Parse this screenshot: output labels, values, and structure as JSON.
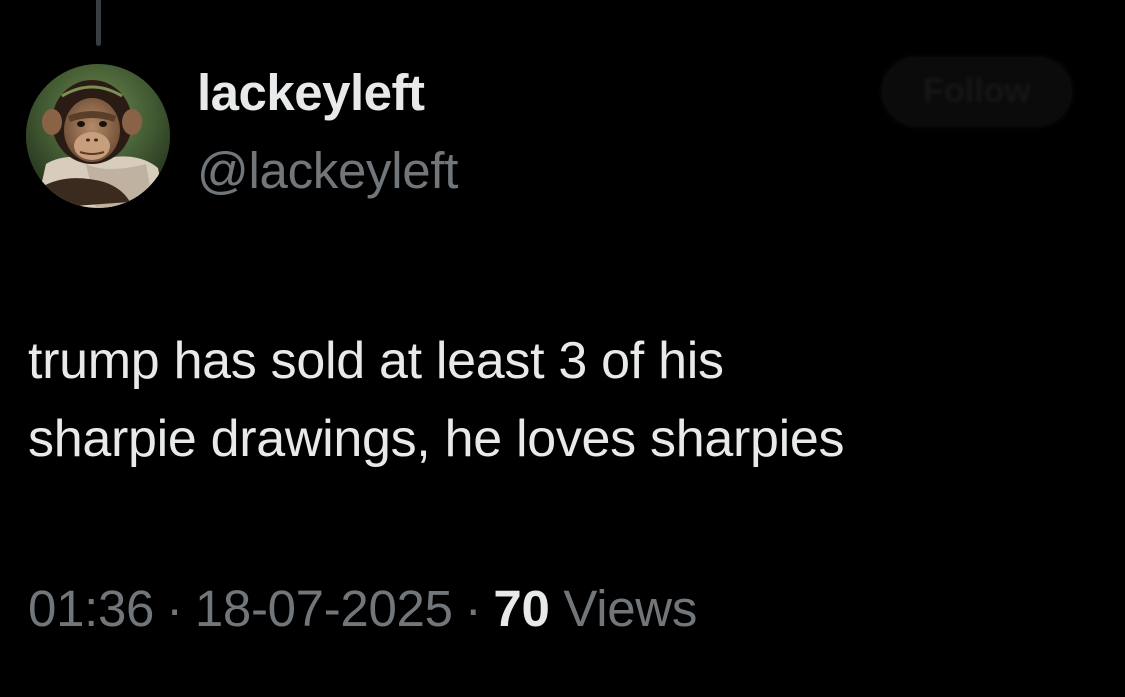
{
  "tweet": {
    "display_name": "lackeyleft",
    "handle": "@lackeyleft",
    "avatar_icon": "chimpanzee-avatar",
    "follow_label": "Follow",
    "text_lines": [
      "trump has sold at least 3 of his",
      "sharpie drawings, he loves sharpies"
    ],
    "time": "01:36",
    "date": "18-07-2025",
    "separator": "·",
    "views_count": "70",
    "views_label": "Views"
  },
  "colors": {
    "background": "#000000",
    "primary_text": "#e7e9ea",
    "secondary_text": "#71767b"
  }
}
